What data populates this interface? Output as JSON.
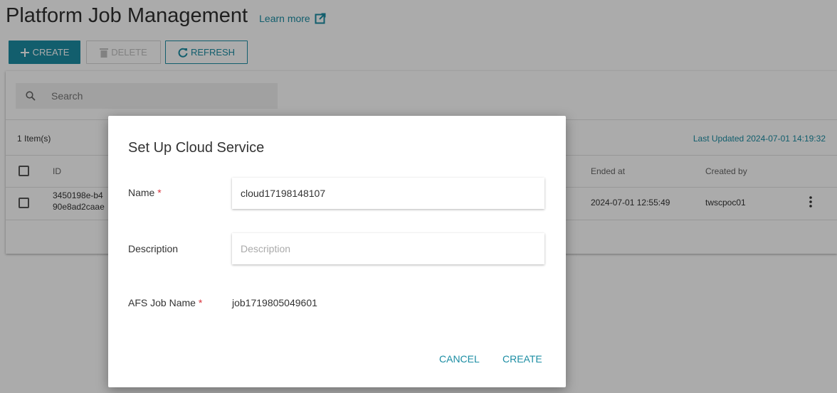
{
  "page": {
    "title": "Platform Job Management",
    "learn_more": "Learn more"
  },
  "toolbar": {
    "create_label": "CREATE",
    "delete_label": "DELETE",
    "refresh_label": "REFRESH"
  },
  "search": {
    "placeholder": "Search"
  },
  "list": {
    "item_count": "1 Item(s)",
    "last_updated": "Last Updated 2024-07-01 14:19:32",
    "columns": {
      "id": "ID",
      "ended_at": "Ended at",
      "created_by": "Created by"
    },
    "rows": [
      {
        "id_line1": "3450198e-b4",
        "id_line2": "90e8ad2caae",
        "ended_at": "2024-07-01 12:55:49",
        "created_by": "twscpoc01"
      }
    ]
  },
  "dialog": {
    "title": "Set Up Cloud Service",
    "name_label": "Name",
    "name_value": "cloud17198148107",
    "description_label": "Description",
    "description_placeholder": "Description",
    "afs_label": "AFS Job Name",
    "afs_value": "job1719805049601",
    "required_mark": "*",
    "cancel_label": "CANCEL",
    "create_label": "CREATE"
  },
  "colors": {
    "accent": "#1b8da3",
    "required": "#d9333c"
  }
}
